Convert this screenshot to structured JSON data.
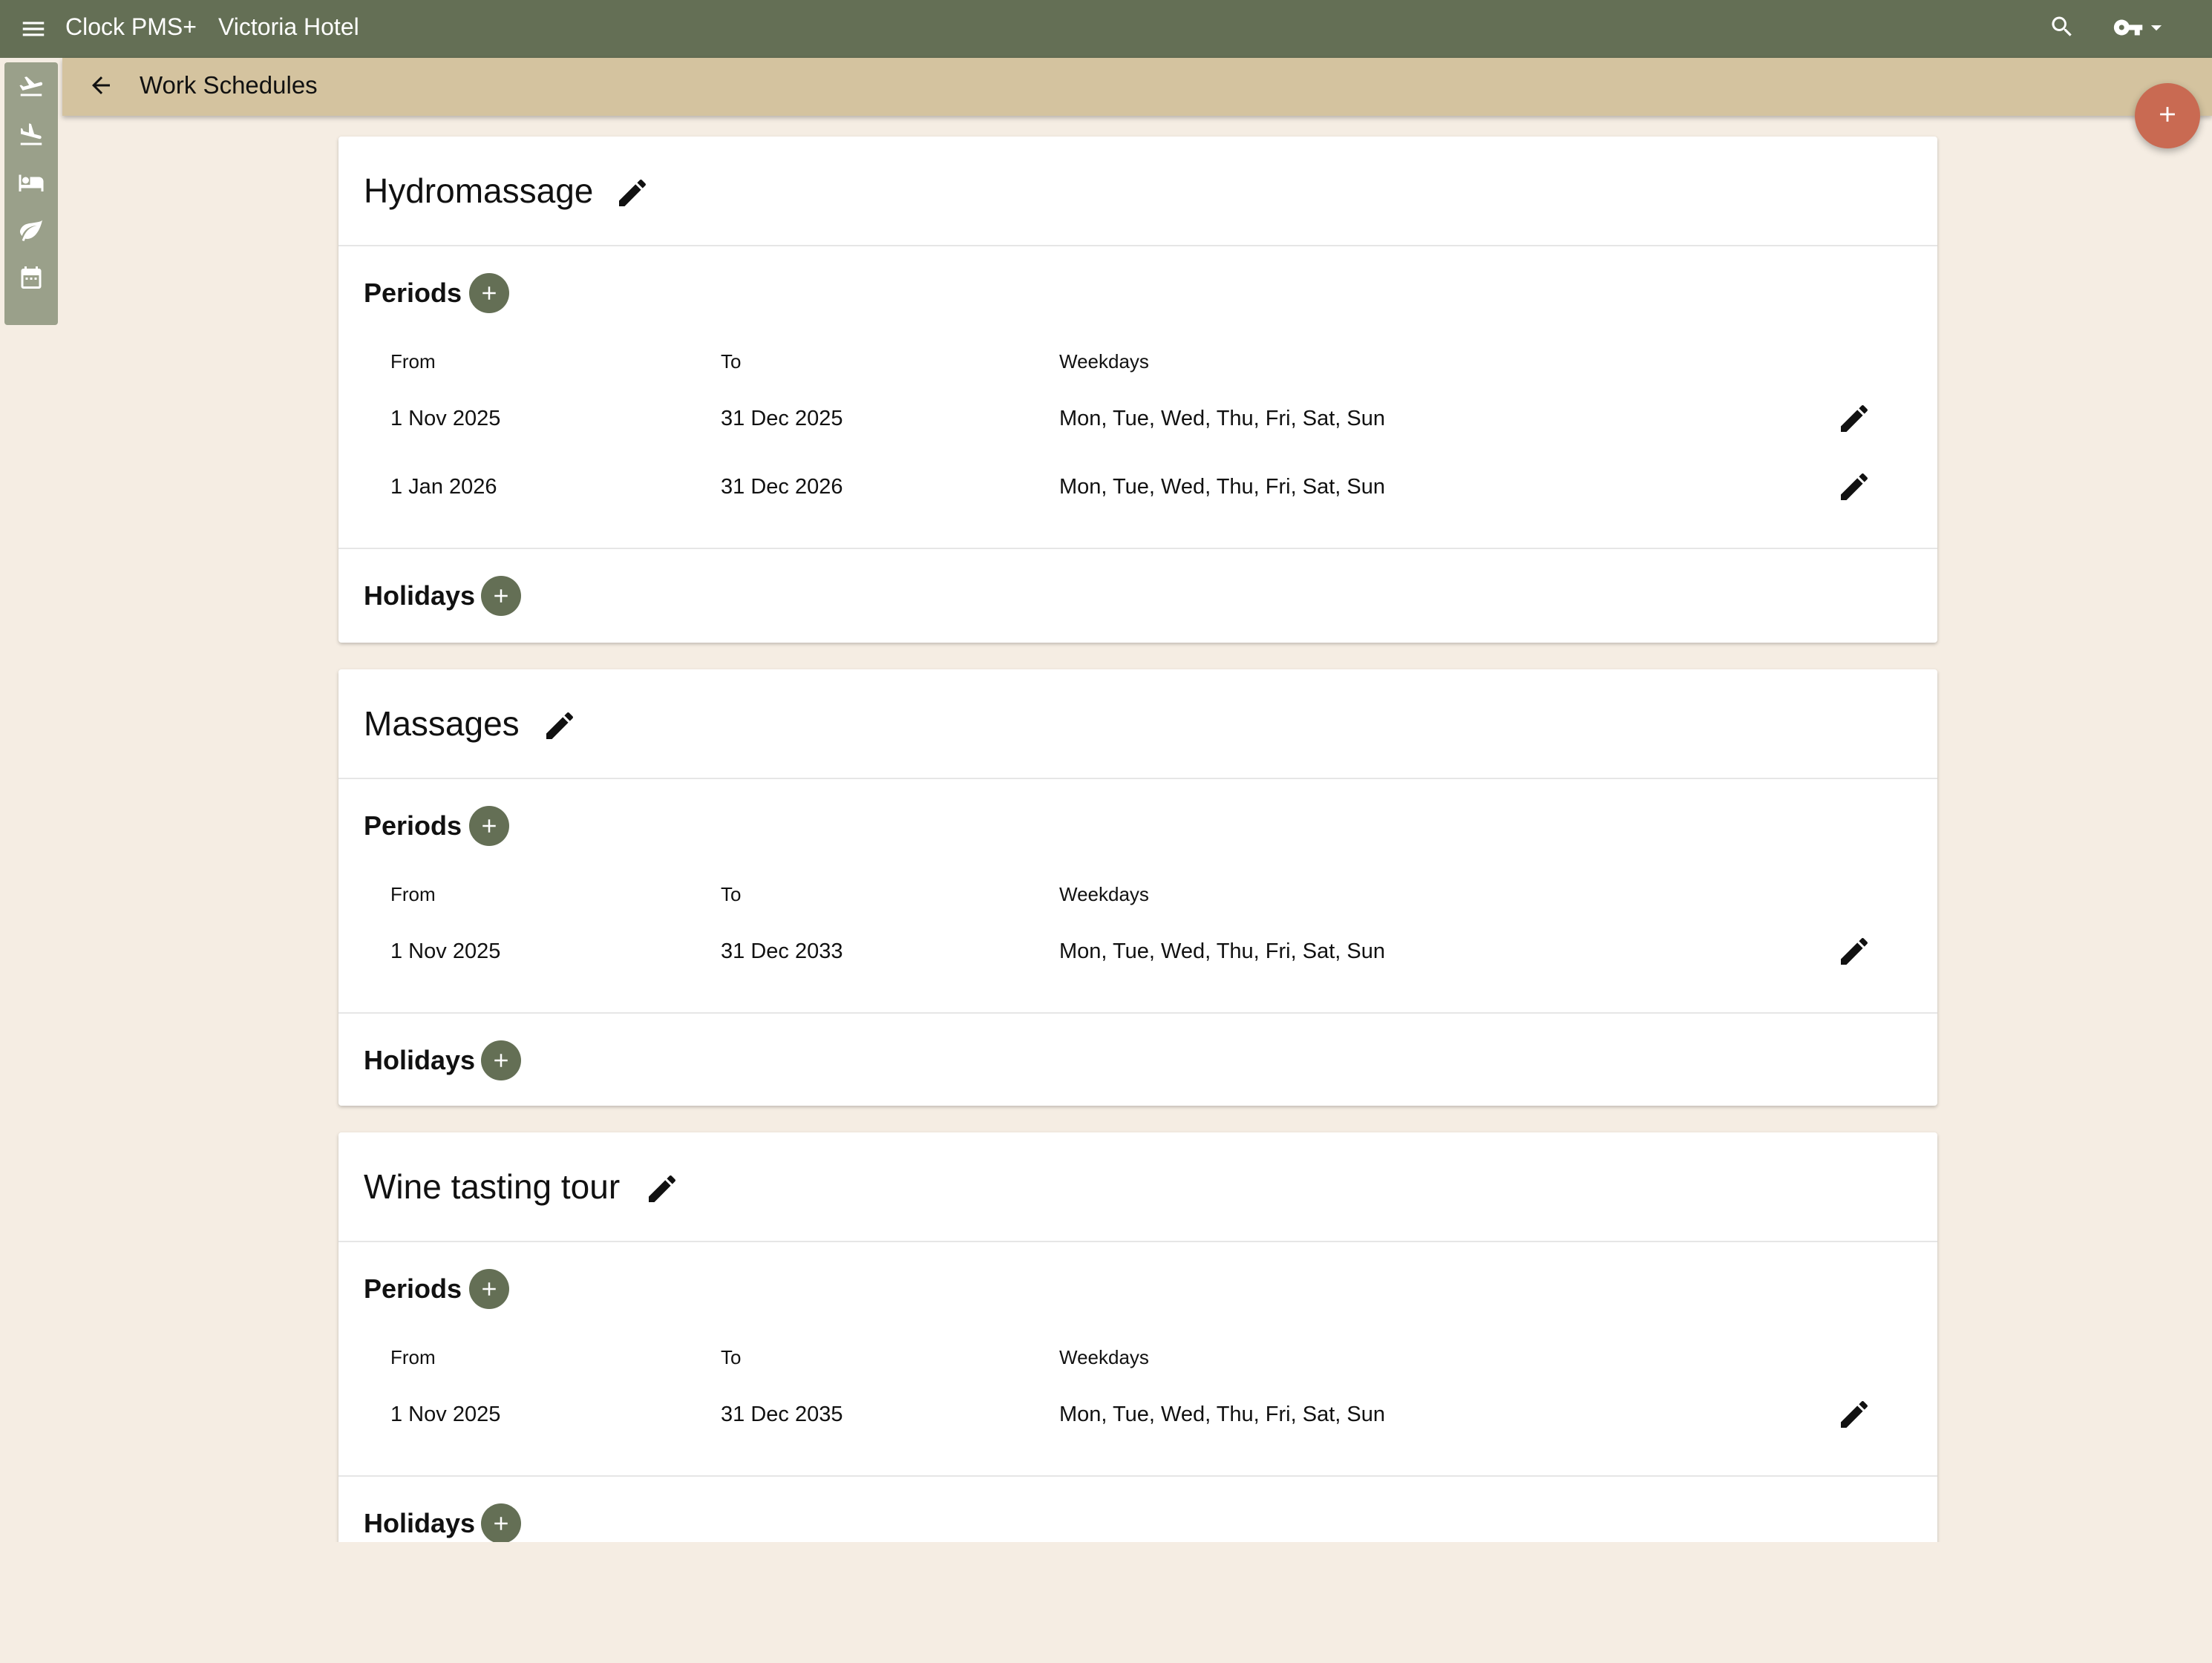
{
  "app": {
    "brand": "Clock PMS+",
    "hotel": "Victoria Hotel",
    "icons": [
      "menu-icon",
      "search-icon",
      "key-icon",
      "arrow-drop-down-icon"
    ]
  },
  "rail": {
    "items": [
      "flight-takeoff-icon",
      "flight-land-icon",
      "bed-icon",
      "leaf-icon",
      "calendar-icon"
    ]
  },
  "subheader": {
    "title": "Work Schedules"
  },
  "colors": {
    "topbar": "#646f55",
    "subheader": "#d4c39f",
    "background": "#f5ede3",
    "fab": "#c96a52",
    "add_button": "#646f55"
  },
  "labels": {
    "periods": "Periods",
    "holidays": "Holidays",
    "from": "From",
    "to": "To",
    "weekdays": "Weekdays"
  },
  "schedules": [
    {
      "name": "Hydromassage",
      "periods": [
        {
          "from": "1 Nov 2025",
          "to": "31 Dec 2025",
          "weekdays": "Mon, Tue, Wed, Thu, Fri, Sat, Sun"
        },
        {
          "from": "1 Jan 2026",
          "to": "31 Dec 2026",
          "weekdays": "Mon, Tue, Wed, Thu, Fri, Sat, Sun"
        }
      ]
    },
    {
      "name": "Massages",
      "periods": [
        {
          "from": "1 Nov 2025",
          "to": "31 Dec 2033",
          "weekdays": "Mon, Tue, Wed, Thu, Fri, Sat, Sun"
        }
      ]
    },
    {
      "name": "Wine tasting tour",
      "periods": [
        {
          "from": "1 Nov 2025",
          "to": "31 Dec 2035",
          "weekdays": "Mon, Tue, Wed, Thu, Fri, Sat, Sun"
        }
      ]
    }
  ]
}
